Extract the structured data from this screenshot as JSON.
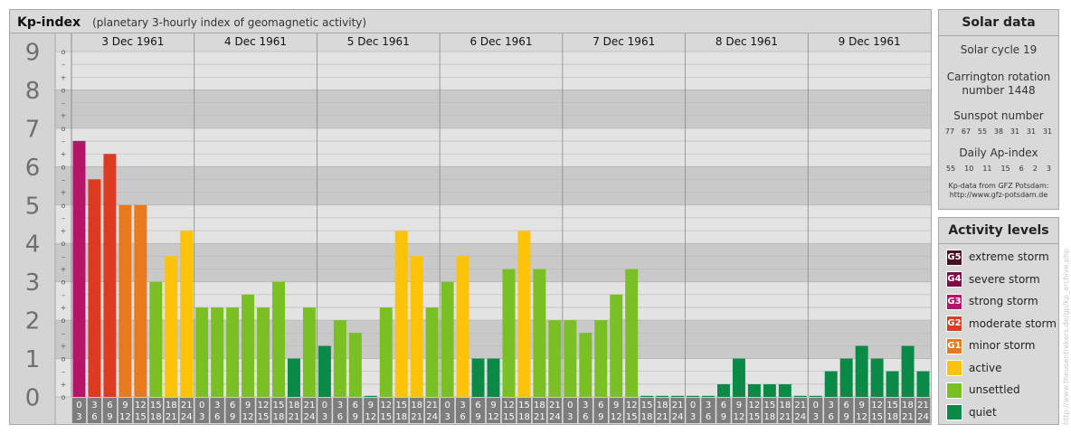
{
  "title": "Kp-index",
  "subtitle": "(planetary 3-hourly index of geomagnetic activity)",
  "chart_data": {
    "type": "bar",
    "ylim": [
      0,
      9
    ],
    "y_ticks": [
      "0",
      "1",
      "2",
      "3",
      "4",
      "5",
      "6",
      "7",
      "8",
      "9"
    ],
    "sub_ticks": [
      "–",
      "+",
      "o"
    ],
    "days": [
      "3 Dec 1961",
      "4 Dec 1961",
      "5 Dec 1961",
      "6 Dec 1961",
      "7 Dec 1961",
      "8 Dec 1961",
      "9 Dec 1961"
    ],
    "intervals": [
      [
        "0",
        "3"
      ],
      [
        "3",
        "6"
      ],
      [
        "6",
        "9"
      ],
      [
        "9",
        "12"
      ],
      [
        "12",
        "15"
      ],
      [
        "15",
        "18"
      ],
      [
        "18",
        "21"
      ],
      [
        "21",
        "24"
      ]
    ],
    "values": [
      [
        6.67,
        5.67,
        6.33,
        5.0,
        5.0,
        3.0,
        3.67,
        4.33
      ],
      [
        2.33,
        2.33,
        2.33,
        2.67,
        2.33,
        3.0,
        1.0,
        2.33
      ],
      [
        1.33,
        2.0,
        1.67,
        0.0,
        2.33,
        4.33,
        3.67,
        2.33
      ],
      [
        3.0,
        3.67,
        1.0,
        1.0,
        3.33,
        4.33,
        3.33,
        2.0
      ],
      [
        2.0,
        1.67,
        2.0,
        2.67,
        3.33,
        0.0,
        0.0,
        0.0
      ],
      [
        0.0,
        0.0,
        0.33,
        1.0,
        0.33,
        0.33,
        0.33,
        0.0
      ],
      [
        0.0,
        0.67,
        1.0,
        1.33,
        1.0,
        0.67,
        1.33,
        0.67
      ]
    ],
    "level_colors": {
      "quiet": "#0b8a47",
      "unsettled": "#7ac025",
      "active": "#fdc308",
      "minor": "#e8791f",
      "moderate": "#dc3b21",
      "strong": "#b5146a",
      "severe": "#7e0d47",
      "extreme": "#4c0f1f"
    }
  },
  "solar_data": {
    "heading": "Solar data",
    "solar_cycle": "Solar cycle 19",
    "carrington_line1": "Carrington rotation",
    "carrington_line2": "number 1448",
    "sunspot_heading": "Sunspot number",
    "sunspot_values": [
      "77",
      "67",
      "55",
      "38",
      "31",
      "31",
      "31"
    ],
    "ap_heading": "Daily Ap-index",
    "ap_values": [
      "55",
      "10",
      "11",
      "15",
      "6",
      "2",
      "3"
    ],
    "source_line1": "Kp-data from  GFZ Potsdam:",
    "source_line2": "http://www.gfz-potsdam.de"
  },
  "activity_levels": {
    "heading": "Activity levels",
    "items": [
      {
        "code": "G5",
        "label": "extreme storm",
        "color": "#4c0f1f"
      },
      {
        "code": "G4",
        "label": "severe storm",
        "color": "#7e0d47"
      },
      {
        "code": "G3",
        "label": "strong storm",
        "color": "#b5146a"
      },
      {
        "code": "G2",
        "label": "moderate storm",
        "color": "#dc3b21"
      },
      {
        "code": "G1",
        "label": "minor storm",
        "color": "#e8791f"
      },
      {
        "code": "",
        "label": "active",
        "color": "#fdc308"
      },
      {
        "code": "",
        "label": "unsettled",
        "color": "#7ac025"
      },
      {
        "code": "",
        "label": "quiet",
        "color": "#0b8a47"
      }
    ]
  },
  "watermark": "http://www.theusentrekers.de/gp/kp_archive.php"
}
